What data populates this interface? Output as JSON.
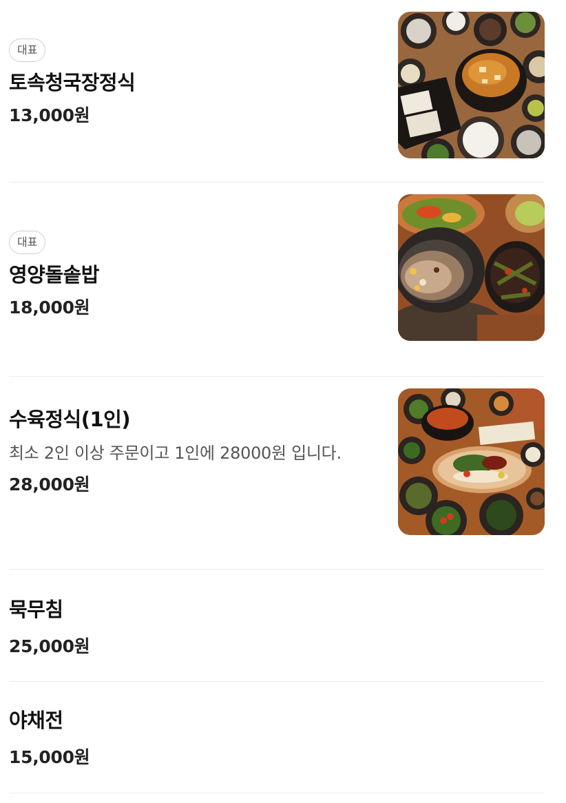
{
  "menu": {
    "items": [
      {
        "badge": "대표",
        "name": "토속청국장정식",
        "price": "13,000원",
        "image": "food-photo"
      },
      {
        "badge": "대표",
        "name": "영양돌솥밥",
        "price": "18,000원",
        "image": "food-photo"
      },
      {
        "name": "수육정식(1인)",
        "description": "최소 2인 이상 주문이고 1인에 28000원 입니다.",
        "price": "28,000원",
        "image": "food-photo"
      },
      {
        "name": "묵무침",
        "price": "25,000원"
      },
      {
        "name": "야채전",
        "price": "15,000원"
      }
    ]
  }
}
